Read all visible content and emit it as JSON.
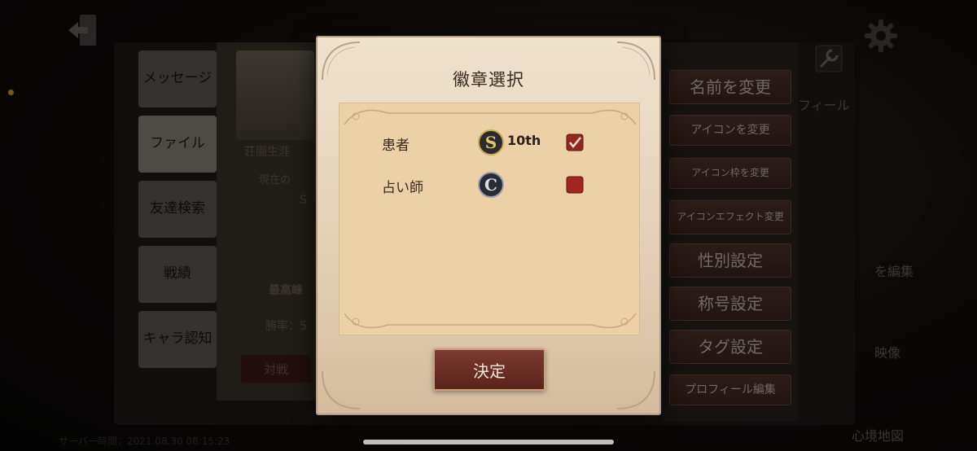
{
  "background": {
    "left_tabs": [
      {
        "label": "メッセージ"
      },
      {
        "label": "ファイル"
      },
      {
        "label": "友達検索"
      },
      {
        "label": "戦績"
      },
      {
        "label": "キャラ認知"
      }
    ],
    "card": {
      "banner": "荘園生涯",
      "current": "現在の",
      "rank_letter": "S",
      "rank_title": "最高峰",
      "win_rate": "勝率：5",
      "battle_button": "対戦"
    },
    "right_buttons": [
      {
        "label": "名前を変更"
      },
      {
        "label": "アイコンを変更"
      },
      {
        "label": "アイコン枠を変更"
      },
      {
        "label": "アイコンエフェクト変更"
      },
      {
        "label": "性別設定"
      },
      {
        "label": "称号設定"
      },
      {
        "label": "タグ設定"
      },
      {
        "label": "プロフィール編集"
      }
    ],
    "side_texts": {
      "profile_tab": "フィール",
      "edit": "を編集",
      "video": "映像",
      "mind_map": "心境地図"
    },
    "footer": "サーバー時間：2021.08.30 08:15:23"
  },
  "modal": {
    "title": "徽章選択",
    "rows": [
      {
        "label": "患者",
        "badge_icon": "s-badge-icon",
        "rank": "10th",
        "checked": true
      },
      {
        "label": "占い師",
        "badge_icon": "c-badge-icon",
        "rank": "",
        "checked": false
      }
    ],
    "confirm_label": "決定"
  },
  "colors": {
    "accent_red": "#7c3b30",
    "parchment": "#efe2ce",
    "panel": "#ecd0a6"
  }
}
